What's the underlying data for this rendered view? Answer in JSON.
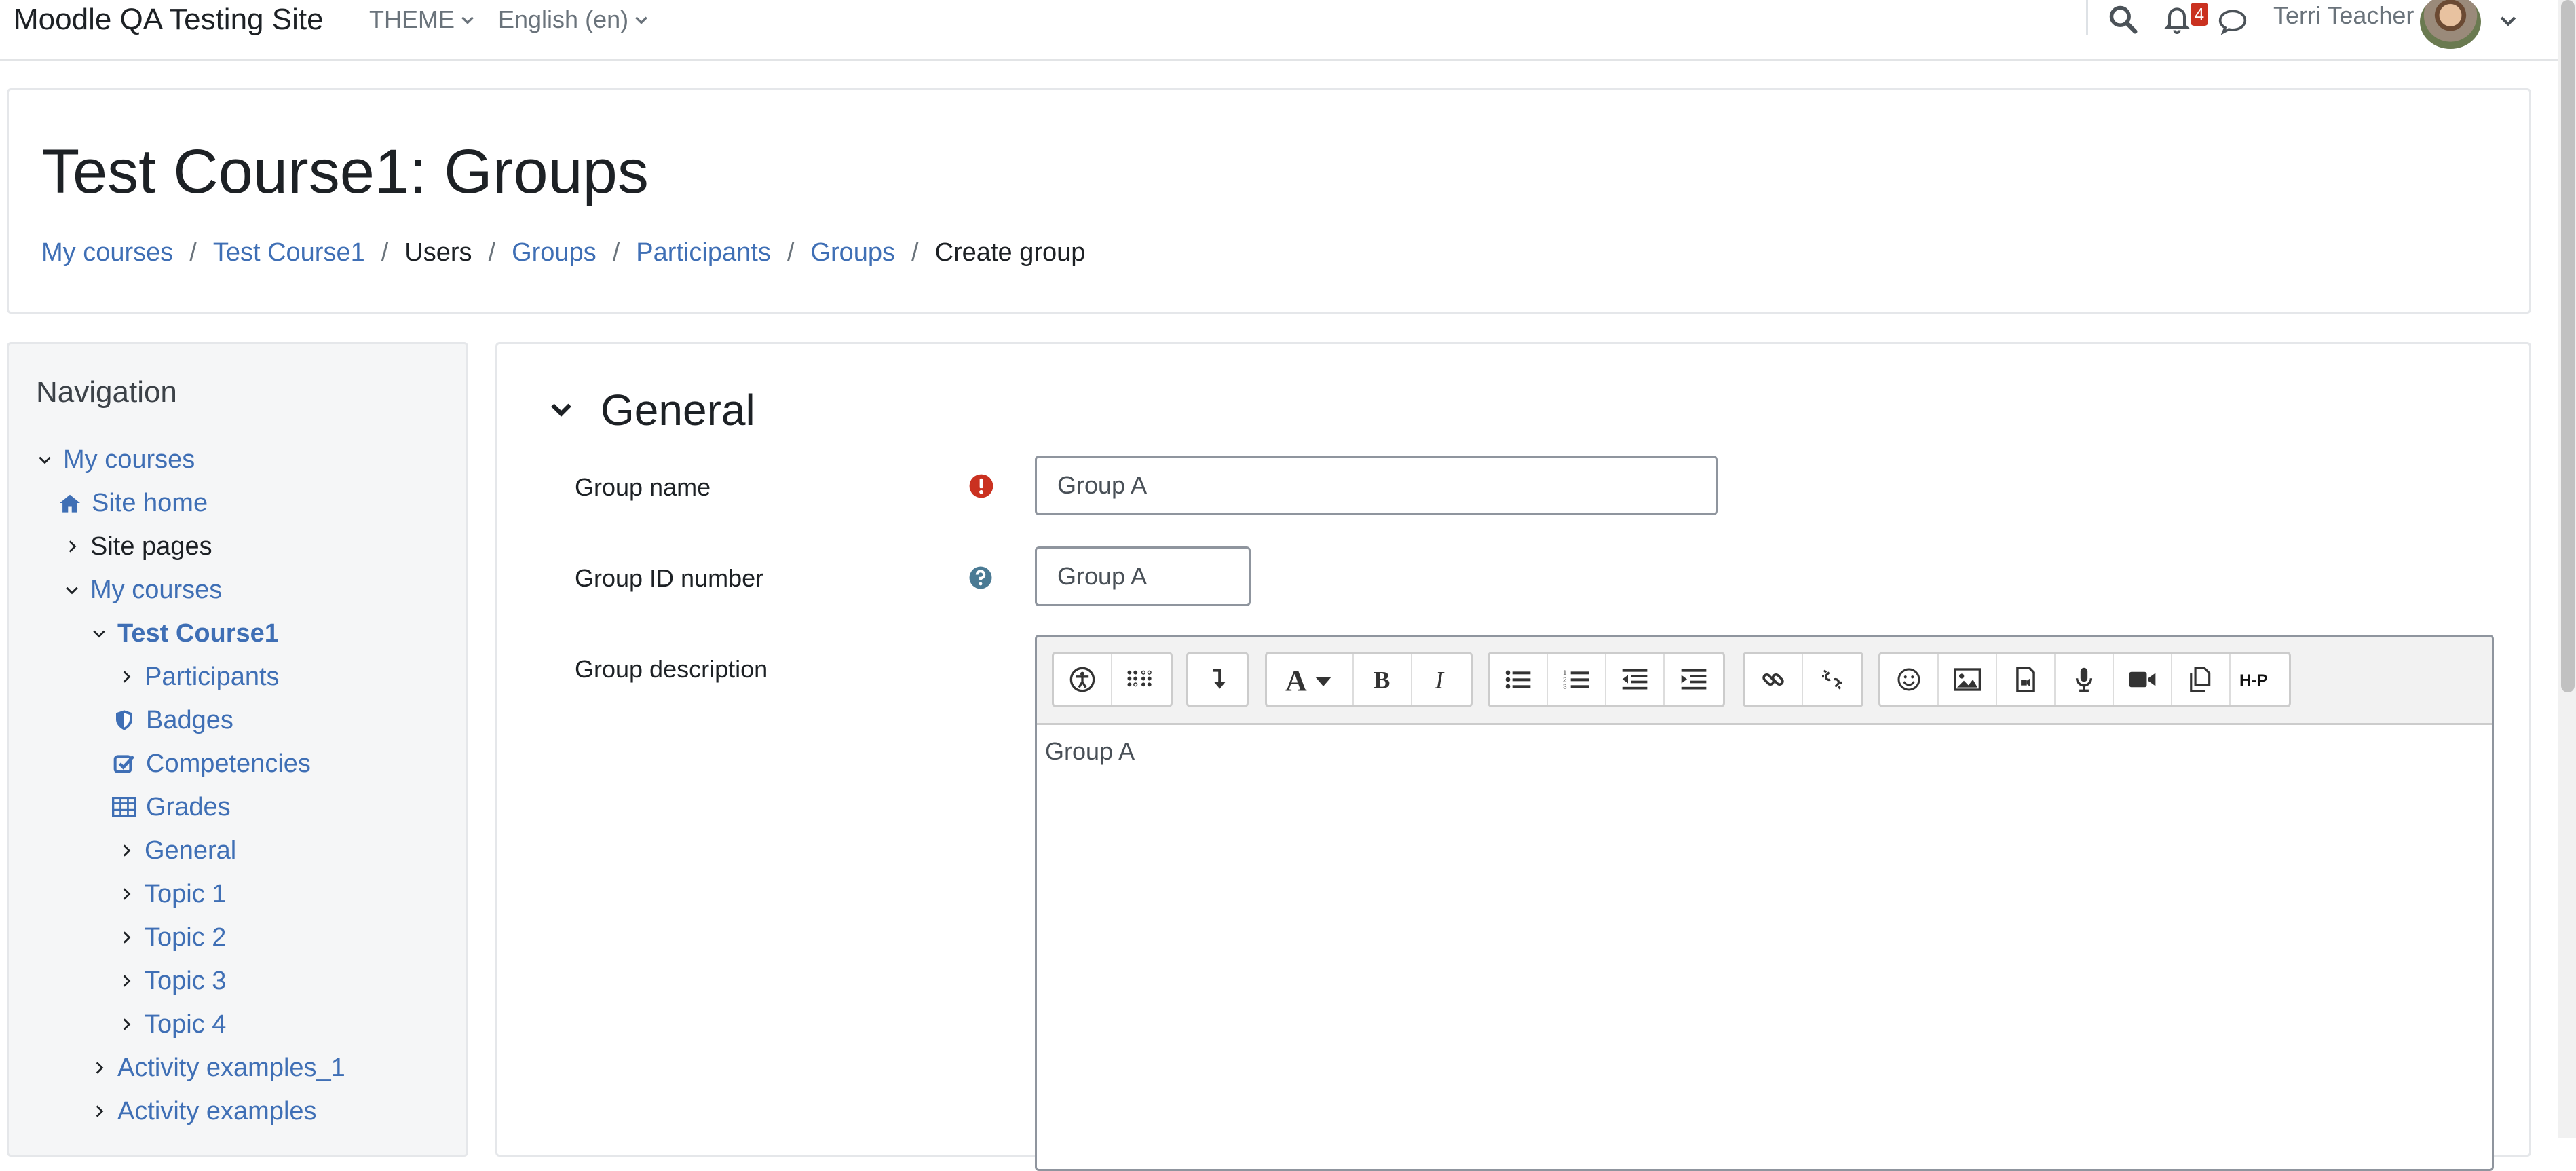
{
  "navbar": {
    "site_name": "Moodle QA Testing Site",
    "theme_label": "THEME",
    "language_label": "English (en)",
    "notification_count": "4",
    "user_name": "Terri Teacher"
  },
  "header": {
    "title": "Test Course1: Groups",
    "breadcrumb": [
      "My courses",
      "Test Course1",
      "Users",
      "Groups",
      "Participants",
      "Groups",
      "Create group"
    ]
  },
  "navigation": {
    "title": "Navigation",
    "items": [
      {
        "label": "My courses"
      },
      {
        "label": "Site home"
      },
      {
        "label": "Site pages"
      },
      {
        "label": "My courses"
      },
      {
        "label": "Test Course1"
      },
      {
        "label": "Participants"
      },
      {
        "label": "Badges"
      },
      {
        "label": "Competencies"
      },
      {
        "label": "Grades"
      },
      {
        "label": "General"
      },
      {
        "label": "Topic 1"
      },
      {
        "label": "Topic 2"
      },
      {
        "label": "Topic 3"
      },
      {
        "label": "Topic 4"
      },
      {
        "label": "Activity examples_1"
      },
      {
        "label": "Activity examples"
      }
    ]
  },
  "form": {
    "section_title": "General",
    "group_name_label": "Group name",
    "group_name_value": "Group A",
    "group_id_label": "Group ID number",
    "group_id_value": "Group A",
    "description_label": "Group description",
    "description_value": "Group A"
  },
  "editor_toolbar": {
    "icons": [
      "accessibility-checker-icon",
      "screenreader-helper-icon",
      "show-more-buttons-icon",
      "font-style-icon",
      "bold-icon",
      "italic-icon",
      "unordered-list-icon",
      "ordered-list-icon",
      "outdent-icon",
      "indent-icon",
      "link-icon",
      "unlink-icon",
      "emoji-icon",
      "image-icon",
      "media-icon",
      "record-audio-icon",
      "record-video-icon",
      "manage-files-icon",
      "h5p-icon"
    ],
    "h5p_text": "H-P"
  },
  "colors": {
    "link": "#3f6fb5",
    "required": "#ca3120",
    "help": "#4a7a94"
  }
}
